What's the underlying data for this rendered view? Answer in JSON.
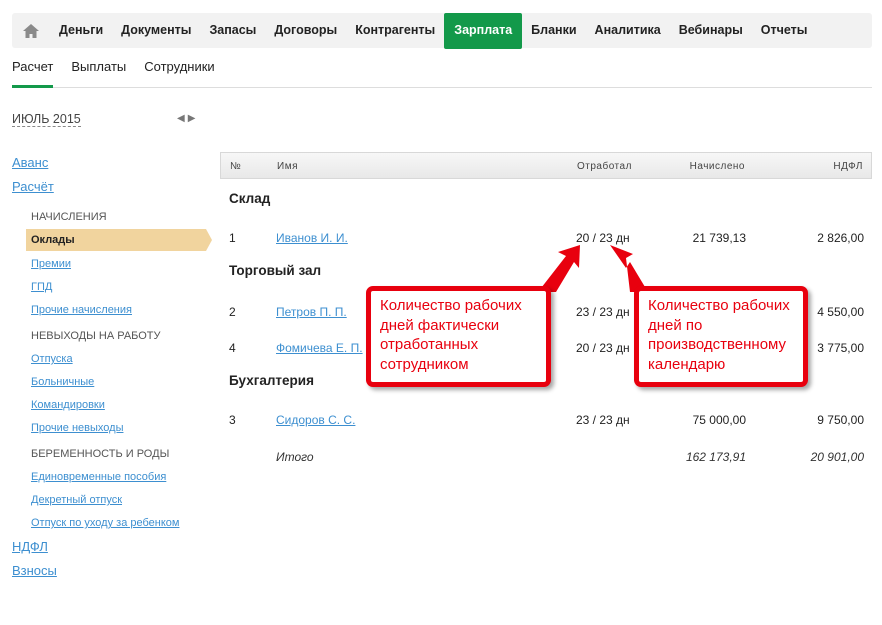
{
  "nav": {
    "items": [
      "Деньги",
      "Документы",
      "Запасы",
      "Договоры",
      "Контрагенты",
      "Зарплата",
      "Бланки",
      "Аналитика",
      "Вебинары",
      "Отчеты"
    ],
    "active": "Зарплата",
    "accent": "#13994a"
  },
  "subtabs": [
    "Расчет",
    "Выплаты",
    "Сотрудники"
  ],
  "period": "ИЮЛЬ 2015",
  "sidebar": {
    "top1": "Аванс",
    "top2": "Расчёт",
    "sec1": "НАЧИСЛЕНИЯ",
    "active": "Оклады",
    "links1": [
      "Премии",
      "ГПД",
      "Прочие начисления"
    ],
    "sec2": "НЕВЫХОДЫ НА РАБОТУ",
    "links2": [
      "Отпуска",
      "Больничные",
      "Командировки",
      "Прочие невыходы"
    ],
    "sec3": "БЕРЕМЕННОСТЬ И РОДЫ",
    "links3": [
      "Единовременные пособия",
      "Декретный отпуск",
      "Отпуск по уходу за ребенком"
    ],
    "bottom1": "НДФЛ",
    "bottom2": "Взносы"
  },
  "table": {
    "headers": {
      "num": "№",
      "name": "Имя",
      "worked": "Отработал",
      "accrued": "Начислено",
      "ndfl": "НДФЛ"
    },
    "groups": [
      {
        "title": "Склад",
        "rows": [
          {
            "num": "1",
            "name": "Иванов И. И.",
            "worked": "20 / 23 дн",
            "accrued": "21 739,13",
            "ndfl": "2 826,00"
          }
        ]
      },
      {
        "title": "Торговый зал",
        "rows": [
          {
            "num": "2",
            "name": "Петров П. П.",
            "worked": "23 / 23 дн",
            "accrued": "",
            "ndfl": "4 550,00"
          },
          {
            "num": "4",
            "name": "Фомичева Е. П.",
            "worked": "20 / 23 дн",
            "accrued": "",
            "ndfl": "3 775,00"
          }
        ]
      },
      {
        "title": "Бухгалтерия",
        "rows": [
          {
            "num": "3",
            "name": "Сидоров С. С.",
            "worked": "23 / 23 дн",
            "accrued": "75 000,00",
            "ndfl": "9 750,00"
          }
        ]
      }
    ],
    "total": {
      "label": "Итого",
      "accrued": "162 173,91",
      "ndfl": "20 901,00"
    }
  },
  "callouts": {
    "left": "Количество рабочих дней фактически отработанных сотрудником",
    "right": "Количество рабочих дней по производственному календарю",
    "color": "#e8000e"
  }
}
